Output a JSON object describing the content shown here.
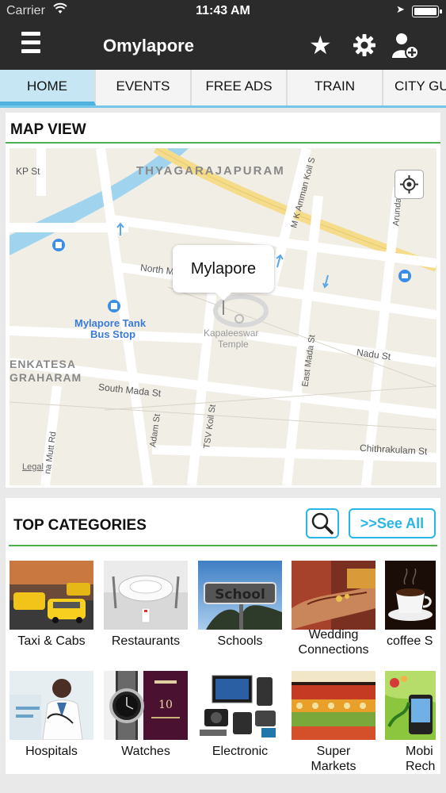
{
  "status_bar": {
    "carrier": "Carrier",
    "time": "11:43 AM"
  },
  "app_bar": {
    "title": "Omylapore"
  },
  "tabs": [
    {
      "label": "HOME",
      "active": true
    },
    {
      "label": "EVENTS",
      "active": false
    },
    {
      "label": "FREE ADS",
      "active": false
    },
    {
      "label": "TRAIN",
      "active": false
    },
    {
      "label": "CITY GU",
      "active": false
    }
  ],
  "map_section": {
    "title": "MAP VIEW",
    "callout": "Mylapore",
    "legal": "Legal",
    "labels": {
      "thyagarajapuram": "THYAGARAJAPURAM",
      "kp_st": "KP St",
      "north_mada": "North Mada St",
      "mk_amman": "M K Amman Koil S",
      "arundale": "Arundale",
      "bus_stop_1": "Mylapore Tank",
      "bus_stop_2": "Bus Stop",
      "kapaleeswar_1": "Kapaleeswar",
      "kapaleeswar_2": "Temple",
      "nadu_st": "Nadu St",
      "venkatesa_1": "ENKATESA",
      "venkatesa_2": "GRAHARAM",
      "south_mada": "South Mada St",
      "east_mada": "East Mada St",
      "adam_st": "Adam St",
      "tsv_koil": "TSV Koil St",
      "mutt_rd": "na Mutt Rd",
      "chithrakulam": "Chithrakulam St"
    }
  },
  "categories_section": {
    "title": "TOP CATEGORIES",
    "see_all": ">>See All",
    "items": [
      {
        "label": "Taxi & Cabs",
        "icon": "taxi-icon"
      },
      {
        "label": "Restaurants",
        "icon": "restaurant-icon"
      },
      {
        "label": "Schools",
        "icon": "school-icon"
      },
      {
        "label": "Wedding\nConnections",
        "icon": "wedding-icon"
      },
      {
        "label": "coffee S",
        "icon": "coffee-icon"
      },
      {
        "label": "Hospitals",
        "icon": "hospital-icon"
      },
      {
        "label": "Watches",
        "icon": "watch-icon"
      },
      {
        "label": "Electronic",
        "icon": "electronics-icon"
      },
      {
        "label": "Super\nMarkets",
        "icon": "supermarket-icon"
      },
      {
        "label": "Mobi\nRecha",
        "icon": "mobile-icon"
      }
    ]
  },
  "colors": {
    "appbar": "#2b2b2b",
    "accent": "#29b6e6",
    "active_tab": "#c7e6f4",
    "rule": "#4caf50"
  }
}
